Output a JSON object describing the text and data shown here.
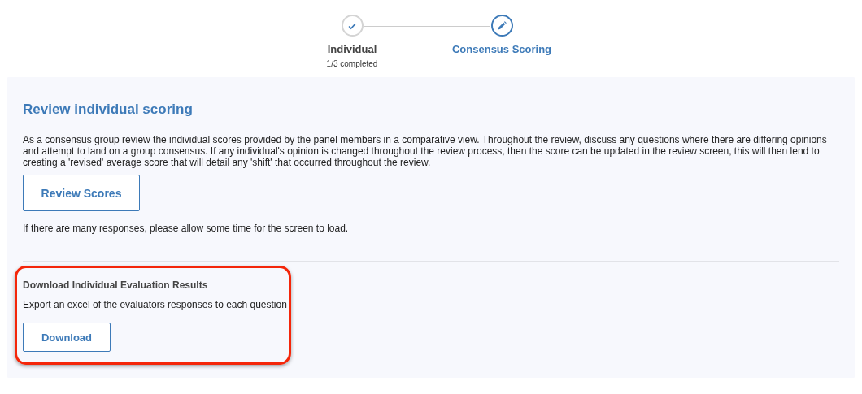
{
  "steps": [
    {
      "label": "Individual",
      "sublabel": "1/3 completed",
      "completed": true,
      "selected": false
    },
    {
      "label": "Consensus Scoring",
      "completed": false,
      "selected": true
    }
  ],
  "review": {
    "title": "Review individual scoring",
    "description": "As a consensus group review the individual scores provided by the panel members in a comparative view. Throughout the review, discuss any questions where there are differing opinions and attempt to land on a group consensus. If any individual's opinion is changed throughout the review process, then the score can be updated in the review screen, this will then lend to creating a 'revised' average score that will detail any 'shift' that occurred throughout the review.",
    "button": "Review Scores",
    "note": "If there are many responses, please allow some time for the screen to load."
  },
  "download": {
    "title": "Download Individual Evaluation Results",
    "description": "Export an excel of the evaluators responses to each question",
    "button": "Download",
    "highlighted": true
  }
}
